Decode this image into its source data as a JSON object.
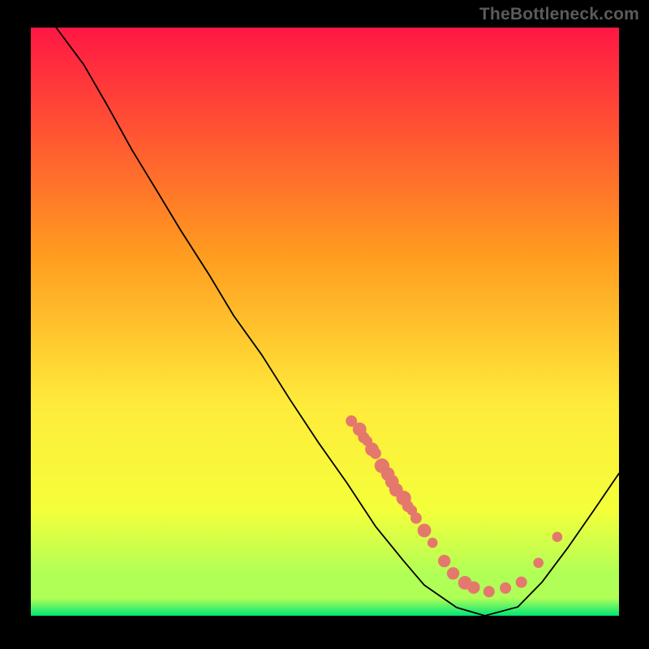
{
  "watermark": "TheBottleneck.com",
  "chart_data": {
    "type": "line",
    "title": "",
    "xlabel": "",
    "ylabel": "",
    "xlim": [
      0,
      100
    ],
    "ylim": [
      0,
      100
    ],
    "grid": false,
    "legend": false,
    "background": {
      "kind": "vertical-gradient",
      "top": "#ff1744",
      "mid1": "#ff9a1f",
      "mid2": "#ffeb3b",
      "mid3": "#f4ff3a",
      "mid4": "#b0ff57",
      "bottom": "#00e676"
    },
    "curve": {
      "points": [
        {
          "x": 4.3,
          "y": 100.0
        },
        {
          "x": 9.0,
          "y": 93.7
        },
        {
          "x": 13.1,
          "y": 86.6
        },
        {
          "x": 17.2,
          "y": 79.2
        },
        {
          "x": 21.4,
          "y": 72.3
        },
        {
          "x": 25.5,
          "y": 65.5
        },
        {
          "x": 30.3,
          "y": 58.0
        },
        {
          "x": 34.5,
          "y": 51.0
        },
        {
          "x": 39.3,
          "y": 44.3
        },
        {
          "x": 44.1,
          "y": 36.7
        },
        {
          "x": 49.0,
          "y": 29.3
        },
        {
          "x": 53.8,
          "y": 22.5
        },
        {
          "x": 58.6,
          "y": 15.2
        },
        {
          "x": 63.4,
          "y": 9.3
        },
        {
          "x": 66.9,
          "y": 5.2
        },
        {
          "x": 72.4,
          "y": 1.4
        },
        {
          "x": 77.2,
          "y": 0.0
        },
        {
          "x": 82.8,
          "y": 1.5
        },
        {
          "x": 86.9,
          "y": 5.7
        },
        {
          "x": 91.4,
          "y": 11.7
        },
        {
          "x": 95.7,
          "y": 17.9
        },
        {
          "x": 100.0,
          "y": 24.2
        }
      ]
    },
    "scatter": {
      "color": "#e5786d",
      "points": [
        {
          "x": 54.5,
          "y": 33.1,
          "r": 1.0
        },
        {
          "x": 55.9,
          "y": 31.7,
          "r": 1.2
        },
        {
          "x": 56.6,
          "y": 30.3,
          "r": 1.0
        },
        {
          "x": 57.2,
          "y": 29.7,
          "r": 0.9
        },
        {
          "x": 58.0,
          "y": 28.3,
          "r": 1.2
        },
        {
          "x": 58.6,
          "y": 27.6,
          "r": 1.0
        },
        {
          "x": 59.7,
          "y": 25.5,
          "r": 1.3
        },
        {
          "x": 60.7,
          "y": 24.1,
          "r": 1.2
        },
        {
          "x": 61.4,
          "y": 22.8,
          "r": 1.2
        },
        {
          "x": 62.1,
          "y": 21.4,
          "r": 1.2
        },
        {
          "x": 63.4,
          "y": 20.0,
          "r": 1.3
        },
        {
          "x": 64.1,
          "y": 18.6,
          "r": 1.0
        },
        {
          "x": 64.8,
          "y": 17.9,
          "r": 0.9
        },
        {
          "x": 65.5,
          "y": 16.6,
          "r": 1.0
        },
        {
          "x": 66.9,
          "y": 14.5,
          "r": 1.2
        },
        {
          "x": 68.3,
          "y": 12.4,
          "r": 0.9
        },
        {
          "x": 70.3,
          "y": 9.3,
          "r": 1.1
        },
        {
          "x": 71.8,
          "y": 7.2,
          "r": 1.1
        },
        {
          "x": 73.8,
          "y": 5.6,
          "r": 1.2
        },
        {
          "x": 75.3,
          "y": 4.8,
          "r": 1.1
        },
        {
          "x": 77.9,
          "y": 4.1,
          "r": 1.0
        },
        {
          "x": 80.7,
          "y": 4.7,
          "r": 1.0
        },
        {
          "x": 83.4,
          "y": 5.7,
          "r": 1.0
        },
        {
          "x": 86.3,
          "y": 9.0,
          "r": 0.9
        },
        {
          "x": 89.5,
          "y": 13.4,
          "r": 0.9
        }
      ]
    }
  }
}
